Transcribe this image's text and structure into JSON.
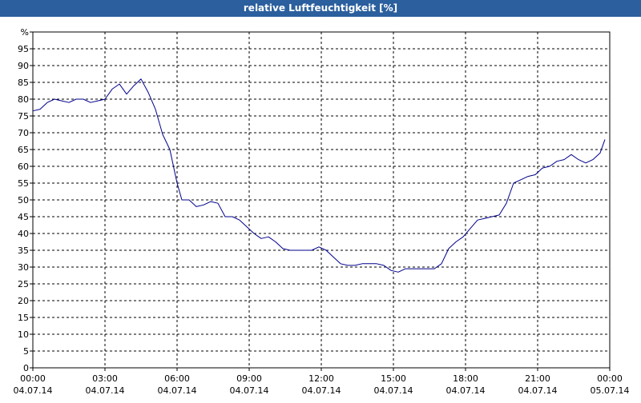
{
  "window": {
    "title": "relative Luftfeuchtigkeit [%]"
  },
  "colors": {
    "title_bar": "#2b5f9e",
    "line": "#00008b",
    "grid": "#000000"
  },
  "chart_data": {
    "type": "line",
    "title": "relative Luftfeuchtigkeit [%]",
    "ylabel": "%",
    "xlabel": "",
    "ylim": [
      0,
      100
    ],
    "y_ticks": [
      0,
      5,
      10,
      15,
      20,
      25,
      30,
      35,
      40,
      45,
      50,
      55,
      60,
      65,
      70,
      75,
      80,
      85,
      90,
      95
    ],
    "x_ticks": [
      {
        "time": "00:00",
        "date": "04.07.14",
        "hour": 0
      },
      {
        "time": "03:00",
        "date": "04.07.14",
        "hour": 3
      },
      {
        "time": "06:00",
        "date": "04.07.14",
        "hour": 6
      },
      {
        "time": "09:00",
        "date": "04.07.14",
        "hour": 9
      },
      {
        "time": "12:00",
        "date": "04.07.14",
        "hour": 12
      },
      {
        "time": "15:00",
        "date": "04.07.14",
        "hour": 15
      },
      {
        "time": "18:00",
        "date": "04.07.14",
        "hour": 18
      },
      {
        "time": "21:00",
        "date": "04.07.14",
        "hour": 21
      },
      {
        "time": "00:00",
        "date": "05.07.14",
        "hour": 24
      }
    ],
    "grid": true,
    "series": [
      {
        "x": [
          0,
          0.3,
          0.6,
          0.9,
          1.2,
          1.5,
          1.8,
          2.1,
          2.4,
          2.7,
          3.0,
          3.3,
          3.6,
          3.9,
          4.2,
          4.5,
          4.8,
          5.1,
          5.4,
          5.7,
          6.0,
          6.2,
          6.5,
          6.8,
          7.1,
          7.4,
          7.7,
          8.0,
          8.3,
          8.6,
          8.9,
          9.2,
          9.5,
          9.8,
          10.1,
          10.4,
          10.7,
          11.0,
          11.3,
          11.6,
          11.9,
          12.2,
          12.5,
          12.8,
          13.1,
          13.4,
          13.7,
          14.0,
          14.3,
          14.6,
          14.9,
          15.2,
          15.5,
          15.8,
          16.1,
          16.4,
          16.7,
          17.0,
          17.3,
          17.6,
          17.9,
          18.2,
          18.5,
          18.8,
          19.1,
          19.4,
          19.7,
          20.0,
          20.3,
          20.6,
          20.9,
          21.2,
          21.5,
          21.8,
          22.1,
          22.4,
          22.7,
          23.0,
          23.3,
          23.6,
          23.8
        ],
        "values": [
          76.5,
          77,
          79,
          80,
          79.5,
          79,
          80,
          80,
          79,
          79.5,
          80,
          83,
          84.5,
          81.5,
          84,
          86,
          82,
          77,
          69.5,
          65,
          55,
          50,
          50,
          48,
          48.5,
          49.5,
          49,
          45,
          45,
          44,
          42,
          40,
          38.5,
          39,
          37.5,
          35.5,
          35,
          35,
          35,
          35,
          36,
          35,
          33,
          31,
          30.5,
          30.5,
          31,
          31,
          31,
          30.5,
          29,
          28.5,
          29.5,
          29.5,
          29.5,
          29.5,
          29.5,
          31,
          35.5,
          37.5,
          39,
          41.5,
          44,
          44.5,
          45,
          45.5,
          49,
          55,
          56,
          57,
          57.5,
          59.5,
          60,
          61.5,
          62,
          63.5,
          62,
          61,
          62,
          64,
          68
        ]
      }
    ]
  }
}
